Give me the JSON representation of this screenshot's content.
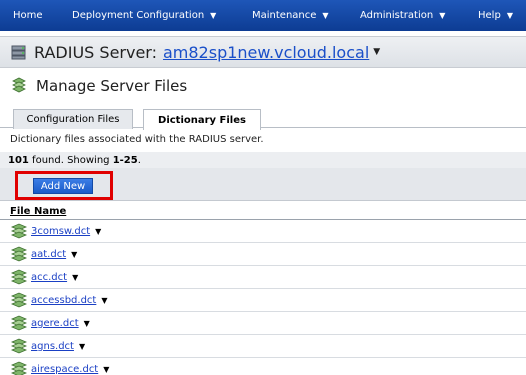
{
  "nav": {
    "items": [
      {
        "label": "Home",
        "has_menu": false
      },
      {
        "label": "Deployment Configuration",
        "has_menu": true
      },
      {
        "label": "Maintenance",
        "has_menu": true
      },
      {
        "label": "Administration",
        "has_menu": true
      },
      {
        "label": "Help",
        "has_menu": true
      }
    ],
    "caret": "▼"
  },
  "server": {
    "label": "RADIUS Server:",
    "name": "am82sp1new.vcloud.local",
    "caret": "▼",
    "icon": "server-icon"
  },
  "page": {
    "title": "Manage Server Files",
    "icon": "files-icon"
  },
  "tabs": [
    {
      "label": "Configuration Files",
      "active": false
    },
    {
      "label": "Dictionary Files",
      "active": true
    }
  ],
  "description": "Dictionary files associated with the RADIUS server.",
  "summary": {
    "count": "101",
    "text": " found. Showing ",
    "range": "1-25",
    "end": "."
  },
  "actions": {
    "add_new_label": "Add New"
  },
  "table": {
    "column_header": "File Name",
    "row_caret": "▼",
    "rows": [
      {
        "name": "3comsw.dct"
      },
      {
        "name": "aat.dct"
      },
      {
        "name": "acc.dct"
      },
      {
        "name": "accessbd.dct"
      },
      {
        "name": "agere.dct"
      },
      {
        "name": "agns.dct"
      },
      {
        "name": "airespace.dct"
      }
    ]
  },
  "colors": {
    "nav_bg": "#1a4fb0",
    "link": "#1a3fc4",
    "highlight_border": "#e00000",
    "button_bg": "#2a6bd8"
  }
}
